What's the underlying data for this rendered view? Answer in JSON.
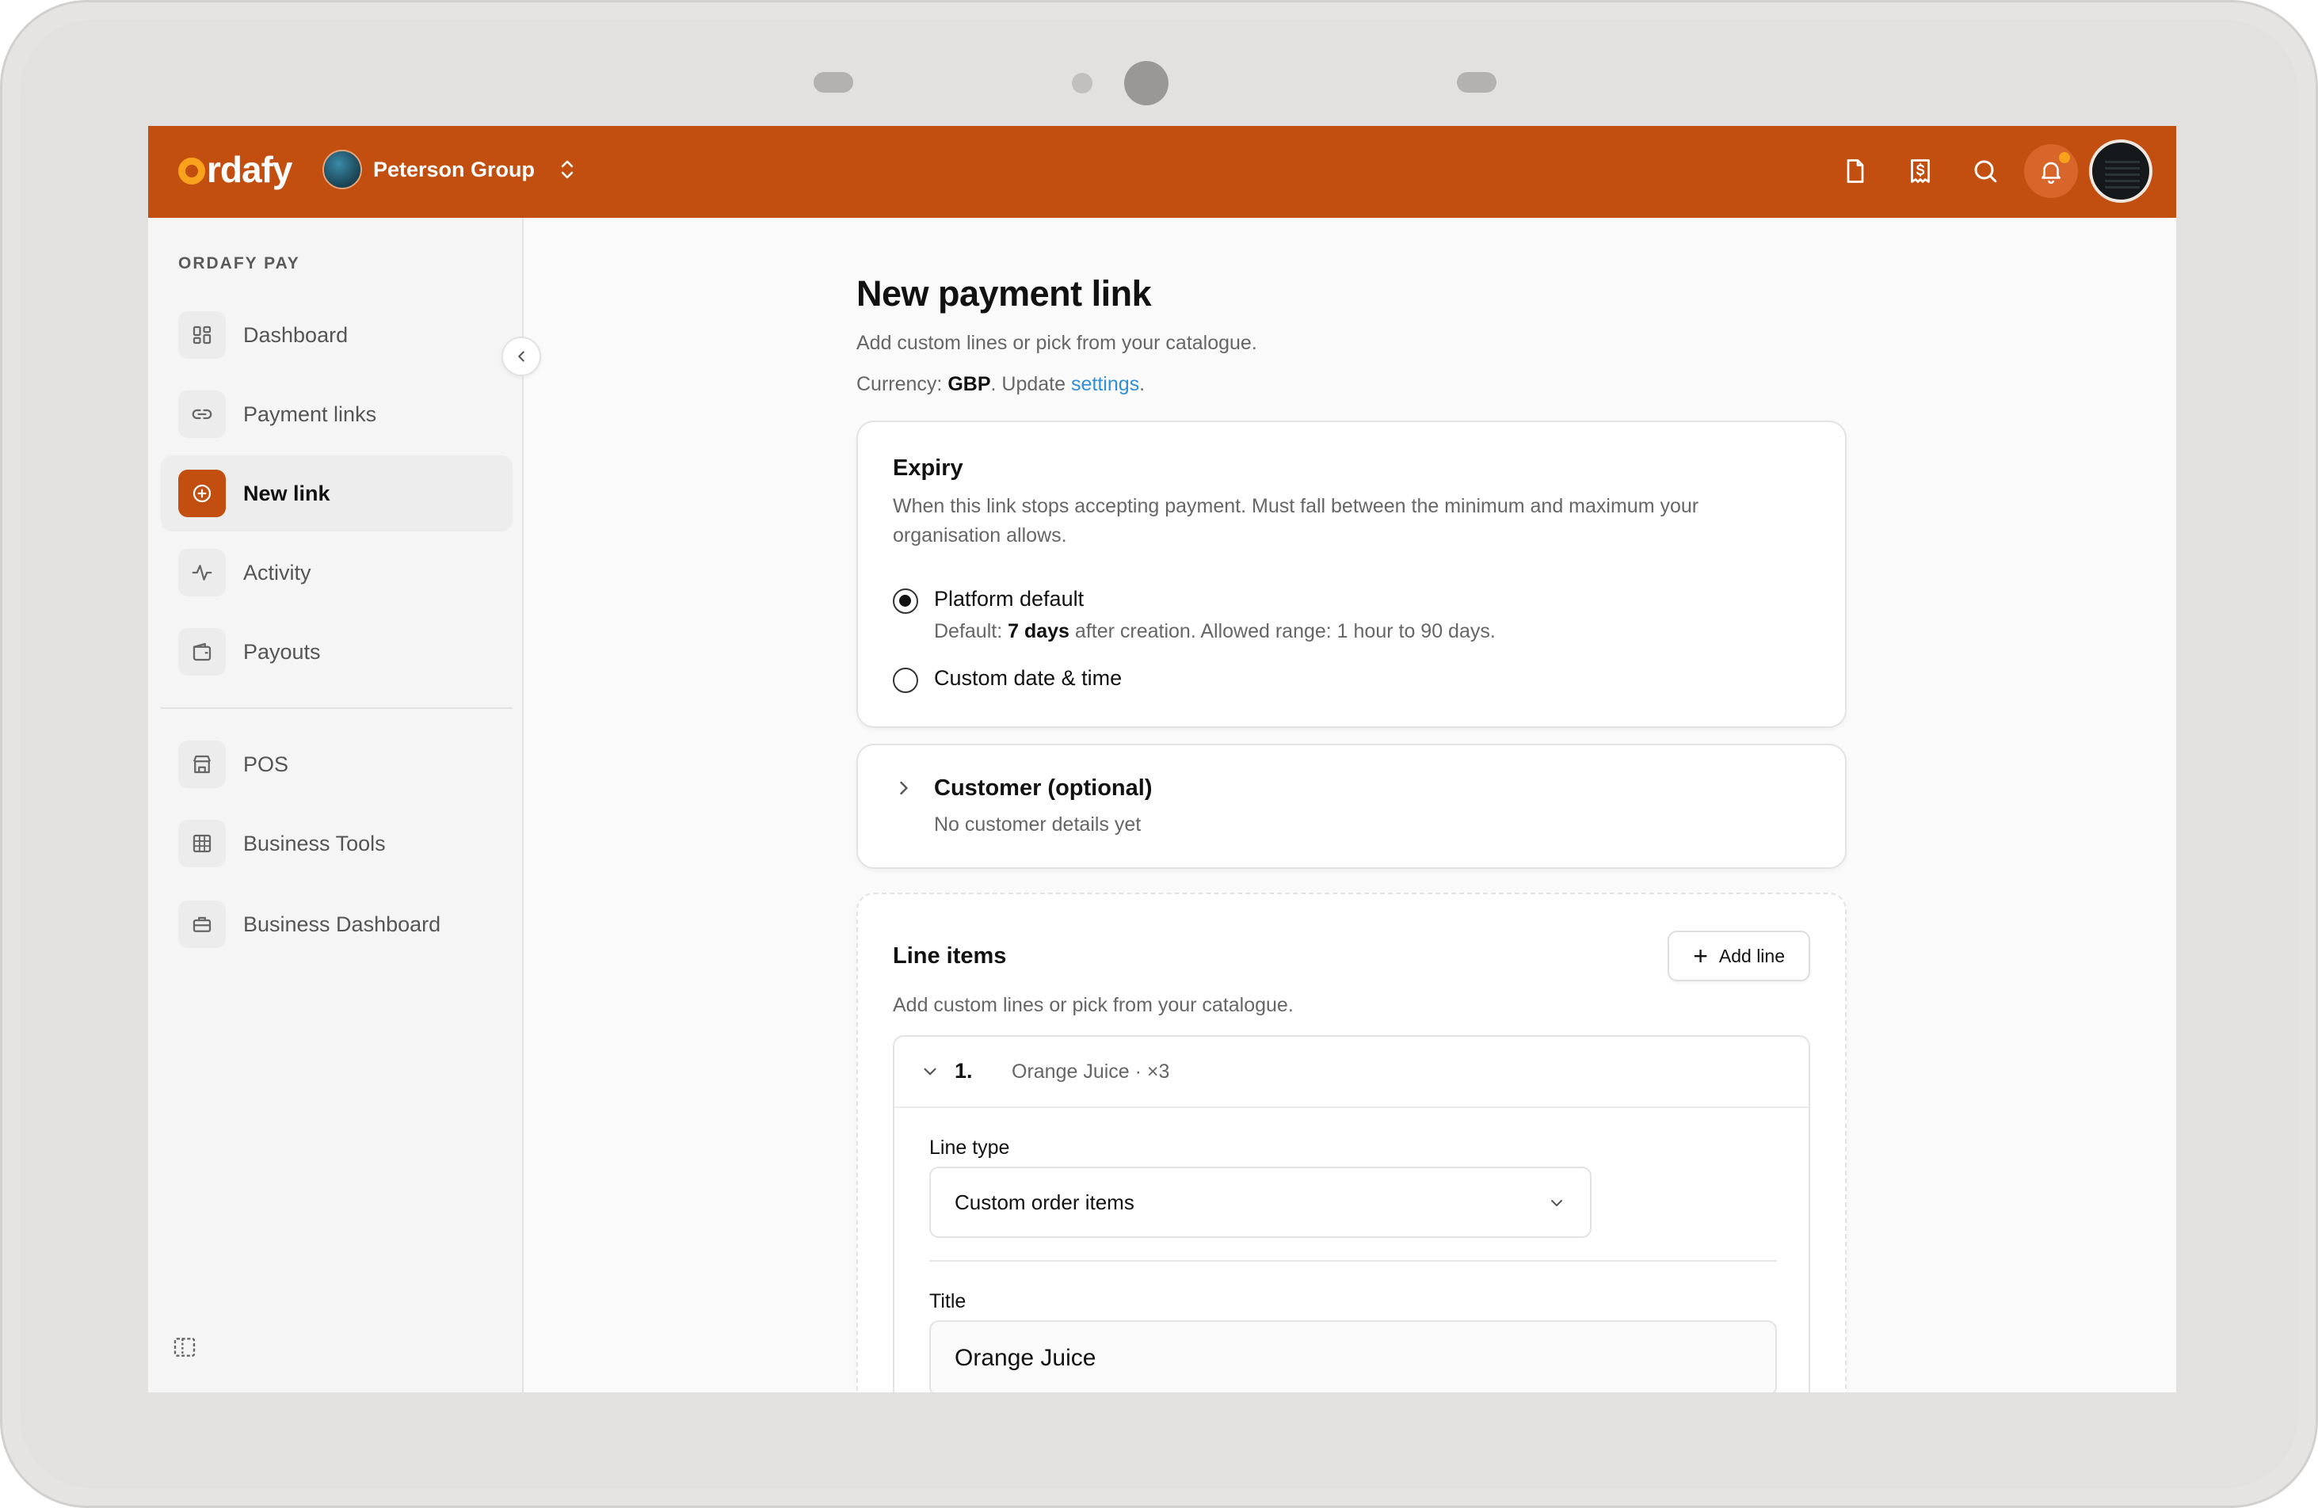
{
  "app": {
    "logo_text": "rdafy",
    "org_name": "Peterson Group"
  },
  "topbar": {
    "icons": [
      "document-icon",
      "receipt-icon",
      "search-icon",
      "bell-icon",
      "user-avatar"
    ],
    "brand_color": "#c24e0f",
    "notification_dot_color": "#f9a21b"
  },
  "sidebar": {
    "section_heading": "ORDAFY PAY",
    "items": [
      {
        "label": "Dashboard",
        "icon": "dashboard-icon"
      },
      {
        "label": "Payment links",
        "icon": "link-icon"
      },
      {
        "label": "New link",
        "icon": "plus-circle-icon",
        "active": true
      },
      {
        "label": "Activity",
        "icon": "activity-icon"
      },
      {
        "label": "Payouts",
        "icon": "wallet-icon"
      }
    ],
    "items2": [
      {
        "label": "POS",
        "icon": "store-icon"
      },
      {
        "label": "Business Tools",
        "icon": "grid-icon"
      },
      {
        "label": "Business Dashboard",
        "icon": "briefcase-icon"
      }
    ]
  },
  "page": {
    "title": "New payment link",
    "subtitle": "Add custom lines or pick from your catalogue.",
    "currency_prefix": "Currency:",
    "currency_code": "GBP",
    "currency_mid": ". Update",
    "currency_link": "settings",
    "currency_end": "."
  },
  "expiry": {
    "title": "Expiry",
    "description": "When this link stops accepting payment. Must fall between the minimum and maximum your organisation allows.",
    "option_default_label": "Platform default",
    "option_default_hint_prefix": "Default:",
    "option_default_hint_value": "7 days",
    "option_default_hint_suffix": "after creation. Allowed range: 1 hour to 90 days.",
    "option_custom_label": "Custom date & time",
    "selected": "Platform default"
  },
  "customer": {
    "title": "Customer (optional)",
    "subtitle": "No customer details yet"
  },
  "line_items": {
    "title": "Line items",
    "add_button": "Add line",
    "subtitle": "Add custom lines or pick from your catalogue.",
    "lines": [
      {
        "index": "1.",
        "summary": "Orange Juice · ×3",
        "line_type_label": "Line type",
        "line_type_value": "Custom order items",
        "title_label": "Title",
        "title_value": "Orange Juice"
      }
    ]
  }
}
